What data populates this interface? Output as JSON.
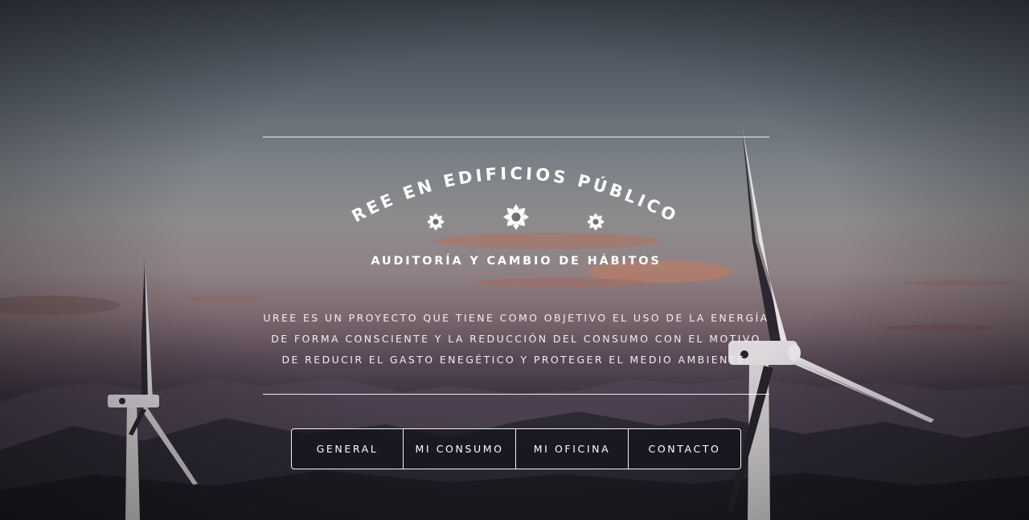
{
  "hero": {
    "arc_title": "UREE EN EDIFICIOS PÚBLICOS",
    "subtitle": "AUDITORÍA Y CAMBIO DE HÁBITOS",
    "description": "UREE ES UN PROYECTO QUE TIENE COMO OBJETIVO EL USO DE LA ENERGÍA DE FORMA CONSCIENTE Y LA REDUCCIÓN DEL CONSUMO CON EL MOTIVO DE REDUCIR EL GASTO ENEGÉTICO Y PROTEGER EL MEDIO AMBIENTE.",
    "icons": [
      "sun-icon",
      "sun-icon",
      "sun-icon"
    ],
    "background": "wind-turbines-sunset-photo"
  },
  "nav": {
    "items": [
      {
        "label": "GENERAL"
      },
      {
        "label": "MI CONSUMO"
      },
      {
        "label": "MI OFICINA"
      },
      {
        "label": "CONTACTO"
      }
    ]
  },
  "colors": {
    "text": "#ffffff",
    "button_bg": "#14121c",
    "rule": "#ffffff"
  }
}
